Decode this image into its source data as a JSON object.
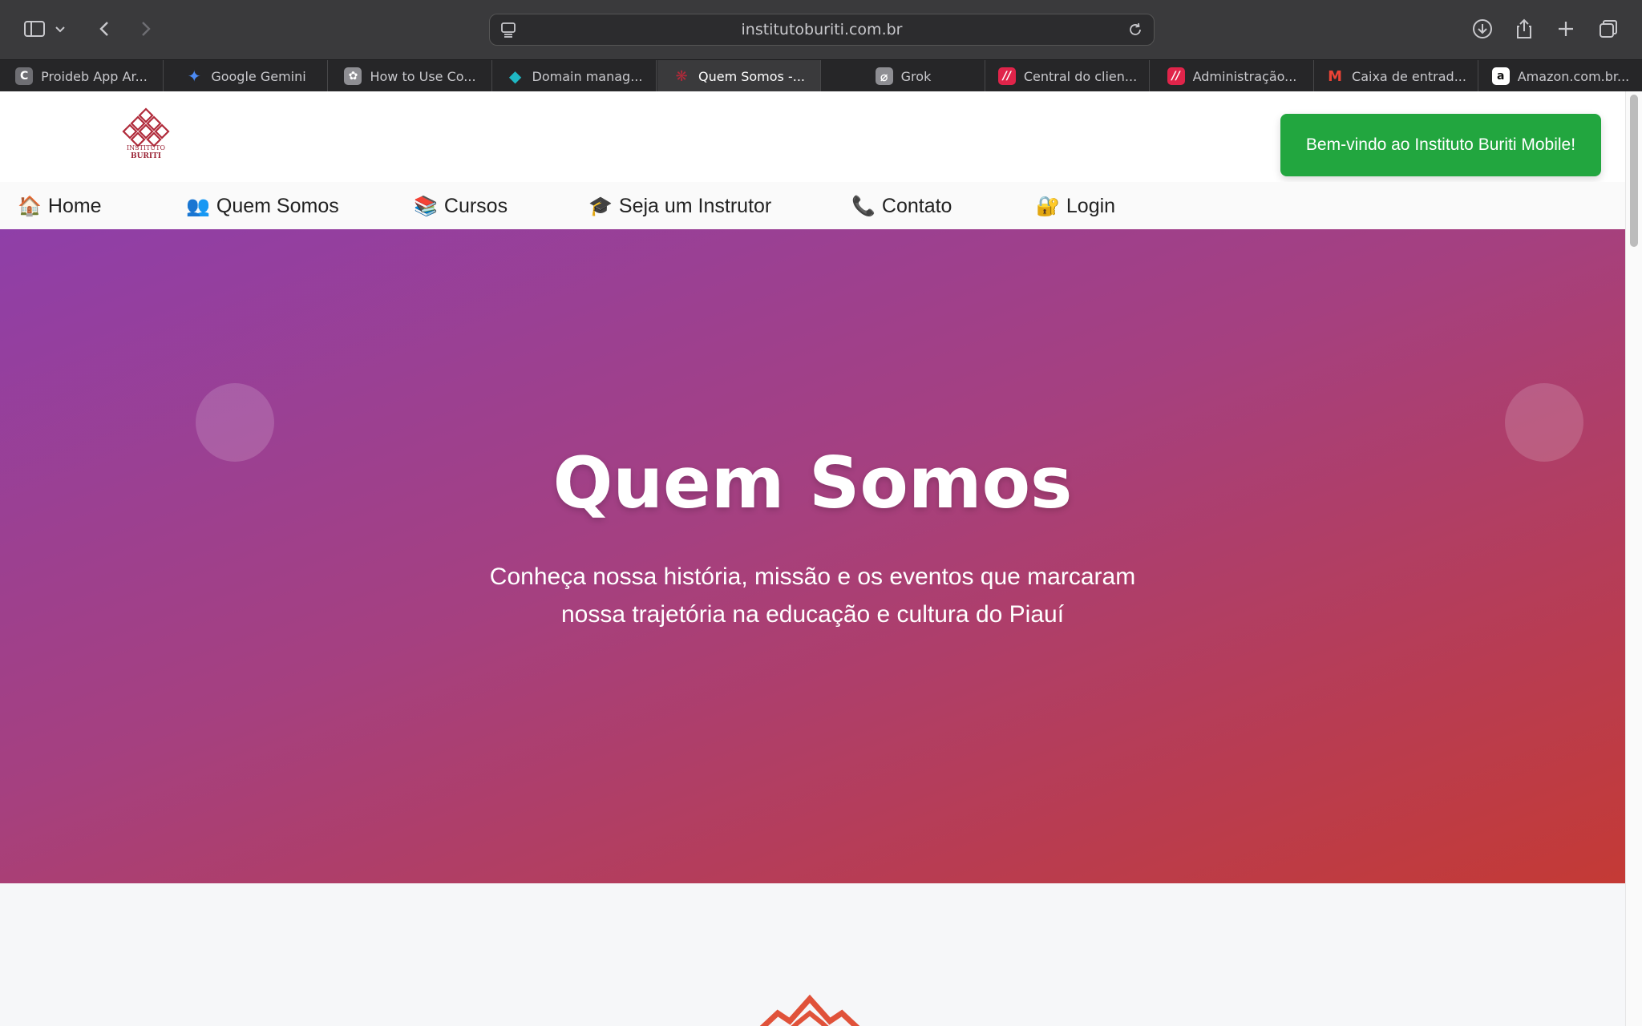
{
  "browser": {
    "url": "institutoburiti.com.br",
    "tabs": [
      {
        "label": "Proideb App Ar...",
        "fav": "C",
        "color": "#6e6e73"
      },
      {
        "label": "Google Gemini",
        "fav": "✦",
        "color": "#4c8bf5"
      },
      {
        "label": "How to Use Co...",
        "fav": "✿",
        "color": "#8e8e93"
      },
      {
        "label": "Domain manag...",
        "fav": "◆",
        "color": "#1fb8c4"
      },
      {
        "label": "Quem Somos -...",
        "fav": "❋",
        "color": "#b02a3a",
        "active": true
      },
      {
        "label": "Grok",
        "fav": "⌀",
        "color": "#8e8e93"
      },
      {
        "label": "Central do clien...",
        "fav": "//",
        "color": "#e0244a"
      },
      {
        "label": "Administração...",
        "fav": "//",
        "color": "#e0244a"
      },
      {
        "label": "Caixa de entrad...",
        "fav": "M",
        "color": "#ea4335"
      },
      {
        "label": "Amazon.com.br...",
        "fav": "a",
        "color": "#111111"
      }
    ]
  },
  "header": {
    "logo_line1": "INSTITUTO",
    "logo_line2": "BURITI",
    "welcome_button": "Bem-vindo ao Instituto Buriti Mobile!"
  },
  "nav": [
    {
      "emoji": "🏠",
      "label": "Home"
    },
    {
      "emoji": "👥",
      "label": "Quem Somos"
    },
    {
      "emoji": "📚",
      "label": "Cursos"
    },
    {
      "emoji": "🎓",
      "label": "Seja um Instrutor"
    },
    {
      "emoji": "📞",
      "label": "Contato"
    },
    {
      "emoji": "🔐",
      "label": "Login"
    }
  ],
  "hero": {
    "title": "Quem Somos",
    "subtitle_line1": "Conheça nossa história, missão e os eventos que marcaram",
    "subtitle_line2": "nossa trajetória na educação e cultura do Piauí"
  },
  "colors": {
    "welcome_green": "#22a63f",
    "hero_gradient_start": "#8f3fa8",
    "hero_gradient_end": "#c43a35",
    "accent_red": "#b02a3a"
  }
}
